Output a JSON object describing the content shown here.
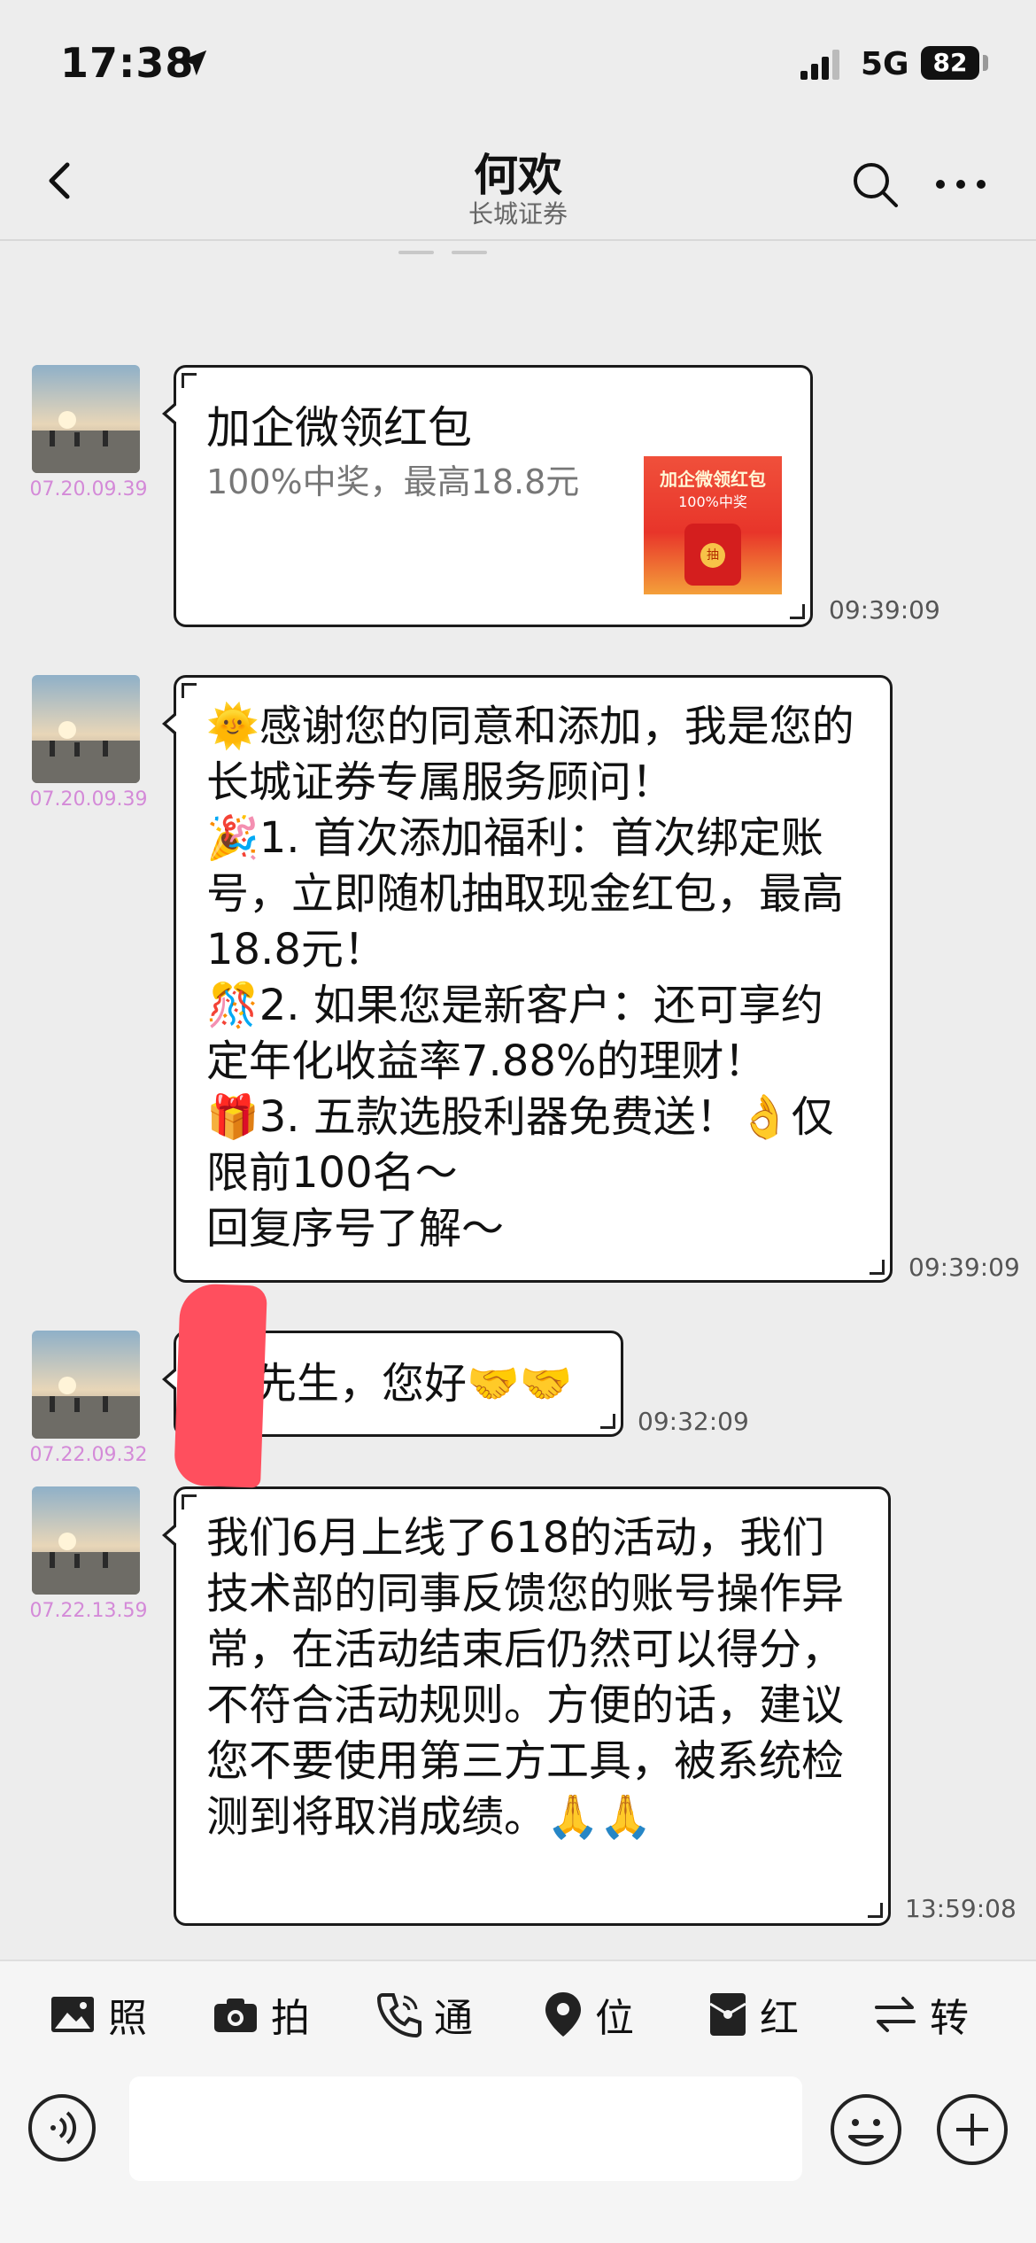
{
  "status_bar": {
    "time": "17:38",
    "network": "5G",
    "battery": "82"
  },
  "header": {
    "title": "何欢",
    "subtitle": "长城证券"
  },
  "messages": [
    {
      "kind": "card",
      "avatar_label": "07.20.09.39",
      "card_title": "加企微领红包",
      "card_desc": "100%中奖，最高18.8元",
      "thumb_line1": "加企微领红包",
      "thumb_line2": "100%中奖",
      "thumb_coin": "抽",
      "time": "09:39:09"
    },
    {
      "kind": "text",
      "avatar_label": "07.20.09.39",
      "text": "🌞感谢您的同意和添加，我是您的长城证券专属服务顾问！\n🎉1. 首次添加福利：首次绑定账号，立即随机抽取现金红包，最高18.8元！\n🎊2. 如果您是新客户：还可享约定年化收益率7.88%的理财！\n🎁3. 五款选股利器免费送！👌仅限前100名～\n回复序号了解～",
      "time": "09:39:09"
    },
    {
      "kind": "text",
      "avatar_label": "07.22.09.32",
      "text": "先生，您好🤝🤝",
      "time": "09:32:09"
    },
    {
      "kind": "text",
      "avatar_label": "07.22.13.59",
      "text": "我们6月上线了618的活动，我们技术部的同事反馈您的账号操作异常，在活动结束后仍然可以得分， 不符合活动规则。方便的话，建议您不要使用第三方工具，被系统检测到将取消成绩。🙏🙏",
      "time": "13:59:08"
    }
  ],
  "toolbar": [
    {
      "icon": "image-icon",
      "label": "照"
    },
    {
      "icon": "camera-icon",
      "label": "拍"
    },
    {
      "icon": "phone-icon",
      "label": "通"
    },
    {
      "icon": "location-icon",
      "label": "位"
    },
    {
      "icon": "red-packet-icon",
      "label": "红"
    },
    {
      "icon": "transfer-icon",
      "label": "转"
    }
  ],
  "input": {
    "placeholder": ""
  },
  "colors": {
    "background": "#ededed",
    "bubble_border": "#1a1a1a",
    "avatar_label": "#d48ad8",
    "redaction": "#ff4f5e"
  }
}
